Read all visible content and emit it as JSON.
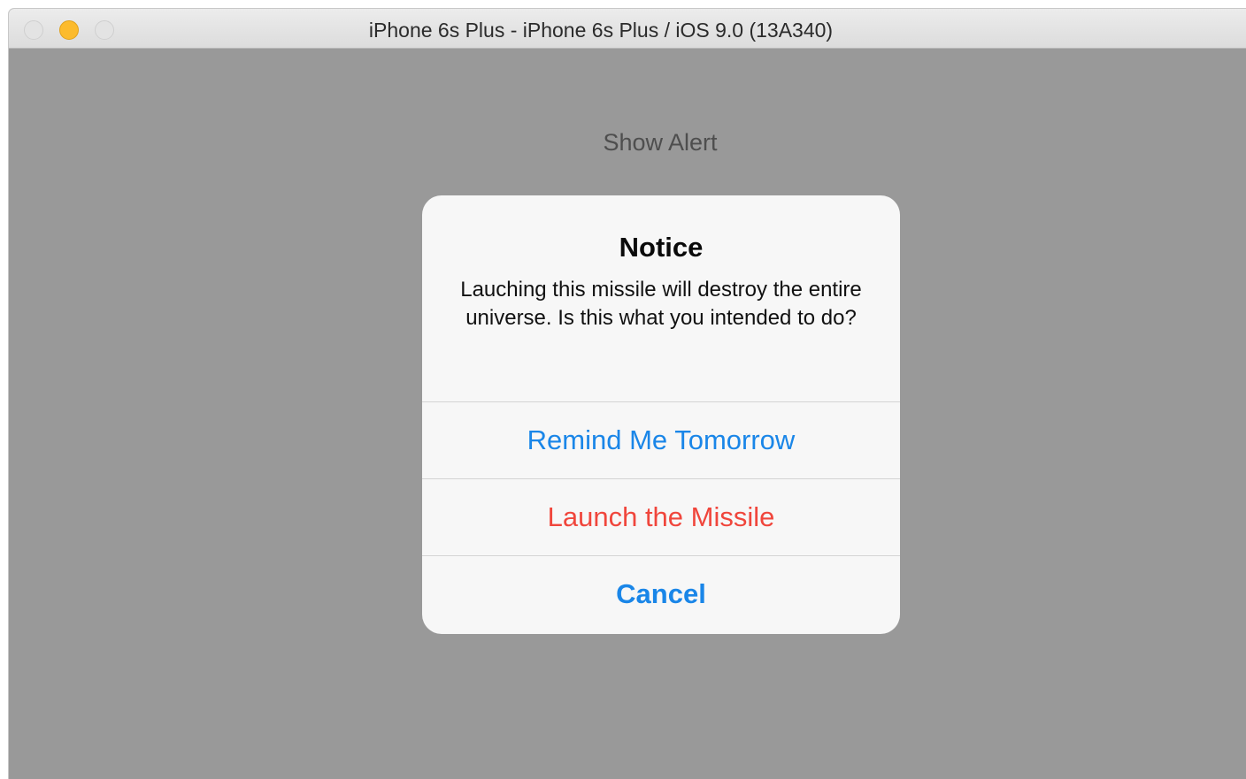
{
  "window": {
    "title": "iPhone 6s Plus - iPhone 6s Plus / iOS 9.0 (13A340)"
  },
  "app": {
    "show_alert_label": "Show Alert"
  },
  "alert": {
    "title": "Notice",
    "message": "Lauching this missile will destroy the entire universe. Is this what you intended to do?",
    "actions": [
      {
        "label": "Remind Me Tomorrow",
        "style": "default"
      },
      {
        "label": "Launch the Missile",
        "style": "destructive"
      },
      {
        "label": "Cancel",
        "style": "cancel"
      }
    ]
  },
  "colors": {
    "action_blue": "#1a86e8",
    "destructive_red": "#f0463c",
    "dimmed_background": "#999999",
    "minimize_yellow": "#fcbb2d"
  }
}
